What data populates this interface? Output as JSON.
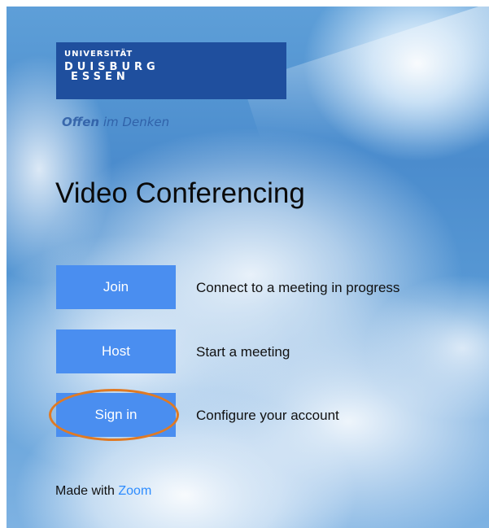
{
  "logo": {
    "line1": "UNIVERSITÄT",
    "line2": "DUISBURG",
    "line3": "ESSEN",
    "slogan_bold": "Offen",
    "slogan_rest": " im Denken"
  },
  "title": "Video Conferencing",
  "actions": [
    {
      "label": "Join",
      "description": "Connect to a meeting in progress"
    },
    {
      "label": "Host",
      "description": "Start a meeting"
    },
    {
      "label": "Sign in",
      "description": "Configure your account"
    }
  ],
  "footer": {
    "prefix": "Made with ",
    "link": "Zoom"
  },
  "colors": {
    "button": "#4a8ef0",
    "logo_bg": "#1f4f9e",
    "highlight": "#e07a23",
    "link": "#2d8cff"
  }
}
